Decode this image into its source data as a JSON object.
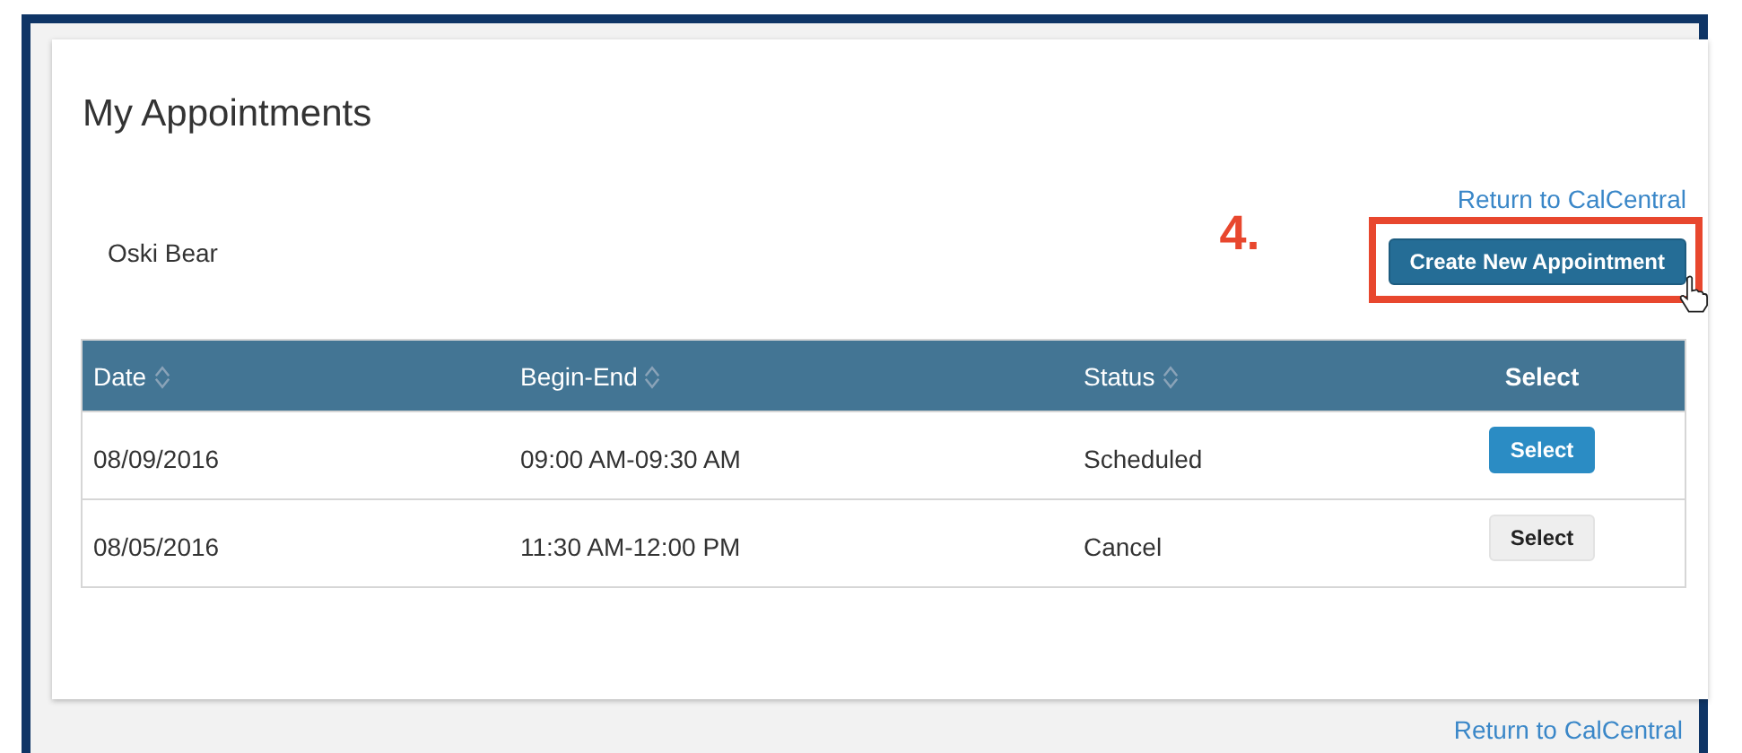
{
  "page": {
    "title": "My Appointments"
  },
  "top_link": "Return to CalCentral",
  "user_name": "Oski Bear",
  "create_button": "Create New Appointment",
  "annotation": {
    "label": "4.",
    "highlighted": true
  },
  "table": {
    "columns": [
      {
        "label": "Date",
        "sortable": true
      },
      {
        "label": "Begin-End",
        "sortable": true
      },
      {
        "label": "Status",
        "sortable": true
      },
      {
        "label": "Select",
        "sortable": false
      }
    ],
    "rows": [
      {
        "date": "08/09/2016",
        "time": "09:00 AM-09:30 AM",
        "status": "Scheduled",
        "button": "Select",
        "selected": true
      },
      {
        "date": "08/05/2016",
        "time": "11:30 AM-12:00 PM",
        "status": "Cancel",
        "button": "Select",
        "selected": false
      }
    ]
  },
  "bottom_link": "Return to CalCentral"
}
